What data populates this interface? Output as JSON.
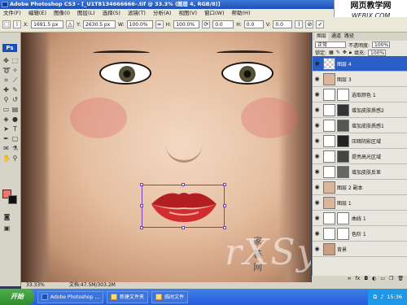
{
  "window": {
    "title": "Adobe Photoshop CS3 - [_U1T8134666666-.tif @ 33.3% (图层 4, RGB/8)]"
  },
  "watermark_logo": {
    "line1": "网页教学网",
    "line2": "WEBJX.COM"
  },
  "menu": [
    "文件(F)",
    "编辑(E)",
    "图像(I)",
    "图层(L)",
    "选择(S)",
    "滤镜(T)",
    "分析(A)",
    "视图(V)",
    "窗口(W)",
    "帮助(H)"
  ],
  "options": {
    "x_label": "X:",
    "x_value": "1691.5 px",
    "y_label": "Y:",
    "y_value": "2630.5 px",
    "w_label": "W:",
    "w_value": "100.0%",
    "h_label": "H:",
    "h_value": "100.0%",
    "angle_value": "0.0",
    "hskew_label": "H:",
    "hskew_value": "0.0",
    "vskew_label": "V:",
    "vskew_value": "0.0"
  },
  "toolbox": {
    "logo": "Ps"
  },
  "canvas": {
    "watermark_text": "rXSy",
    "watermark_cn": "家装网"
  },
  "layers_panel": {
    "tabs": [
      "图层",
      "通道",
      "路径"
    ],
    "blend_mode": "正常",
    "opacity_label": "不透明度:",
    "opacity_value": "100%",
    "lock_label": "锁定:",
    "fill_label": "填充:",
    "fill_value": "100%",
    "layers": [
      {
        "name": "图层 4",
        "selected": true
      },
      {
        "name": "图层 3",
        "selected": false
      },
      {
        "name": "选取颜色 1",
        "selected": false
      },
      {
        "name": "增加皮肤质感2",
        "selected": false
      },
      {
        "name": "增加皮肤质感1",
        "selected": false
      },
      {
        "name": "压暗阴影区域",
        "selected": false
      },
      {
        "name": "提亮高光区域",
        "selected": false
      },
      {
        "name": "增加皮肤反差",
        "selected": false
      },
      {
        "name": "图层 2 副本",
        "selected": false
      },
      {
        "name": "图层 1",
        "selected": false
      },
      {
        "name": "曲线 1",
        "selected": false
      },
      {
        "name": "色阶 1",
        "selected": false
      },
      {
        "name": "背景",
        "selected": false
      }
    ]
  },
  "status": {
    "zoom": "33.33%",
    "doc": "文档:47.5M/303.2M"
  },
  "taskbar": {
    "start": "开始",
    "tasks": [
      "Adobe Photoshop ...",
      "新建文件夹",
      "临时文件"
    ],
    "clock": "15:36"
  }
}
